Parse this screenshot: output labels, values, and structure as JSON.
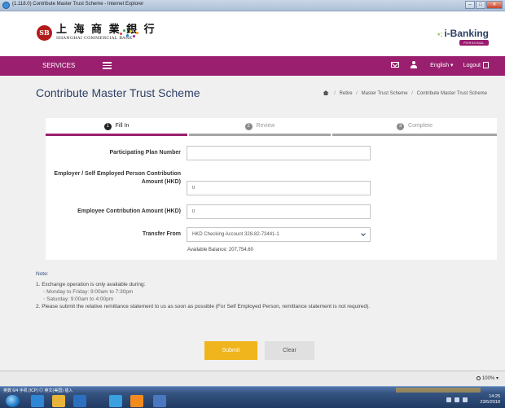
{
  "window": {
    "title": "(1.118.0) Contribute Master Trust Scheme - Internet Explorer",
    "buttons": [
      "–",
      "□",
      "✕"
    ]
  },
  "bank": {
    "seal_text": "SB",
    "name_cn": "上 海 商 業 銀 行",
    "name_en": "SHANGHAI COMMERCIAL BANK",
    "dot_colors": [
      "#e53935",
      "#43a047",
      "#1e88e5",
      "#fdd835",
      "#8e24aa",
      "#fb8c00"
    ]
  },
  "ibanking": {
    "brand": "i-Banking",
    "tag": "PERSONAL"
  },
  "nav": {
    "services": "SERVICES",
    "language": "English ▾",
    "logout": "Logout",
    "accent_color": "#9a1f6e"
  },
  "page": {
    "title": "Contribute Master Trust Scheme",
    "breadcrumb": [
      "Retire",
      "Master Trust Scheme",
      "Contribute Master Trust Scheme"
    ]
  },
  "steps": [
    {
      "num": "1",
      "label": "Fill In",
      "active": true
    },
    {
      "num": "2",
      "label": "Review",
      "active": false
    },
    {
      "num": "3",
      "label": "Complete",
      "active": false
    }
  ],
  "form": {
    "plan_label": "Participating Plan Number",
    "plan_value": "",
    "employer_label_1": "Employer / Self Employed Person Contribution",
    "employer_label_2": "Amount (HKD)",
    "employer_value": "0",
    "employee_label": "Employee Contribution Amount (HKD)",
    "employee_value": "0",
    "transfer_label": "Transfer From",
    "transfer_value": "HKD Checking Account 328-82-73441-1",
    "available_balance": "Available Balance: 207,754.60"
  },
  "note": {
    "title": "Note:",
    "line1": "1. Exchange operation is only available during:",
    "sub1": "Monday to Friday: 9:00am to 7:30pm",
    "sub2": "Saturday: 9:00am to 4:00pm",
    "line2": "2. Please submit the relative remittance statement to us as soon as possible (For Self Employed Person, remittance statement is not required)."
  },
  "buttons": {
    "submit": "Submit",
    "clear": "Clear",
    "submit_color": "#f0b41c"
  },
  "statusbar": {
    "zoom": "100%"
  },
  "taskbar": {
    "ime_text": "英数 6/4  手机 (ICP)  ◎  英文(美国)  插入",
    "time": "14:25",
    "date": "23/5/2018",
    "app_colors": [
      "#2f86d6",
      "#e8b43a",
      "#2c6fbf",
      "#3aa0e0",
      "#f28b1e",
      "#4a78c0"
    ]
  }
}
